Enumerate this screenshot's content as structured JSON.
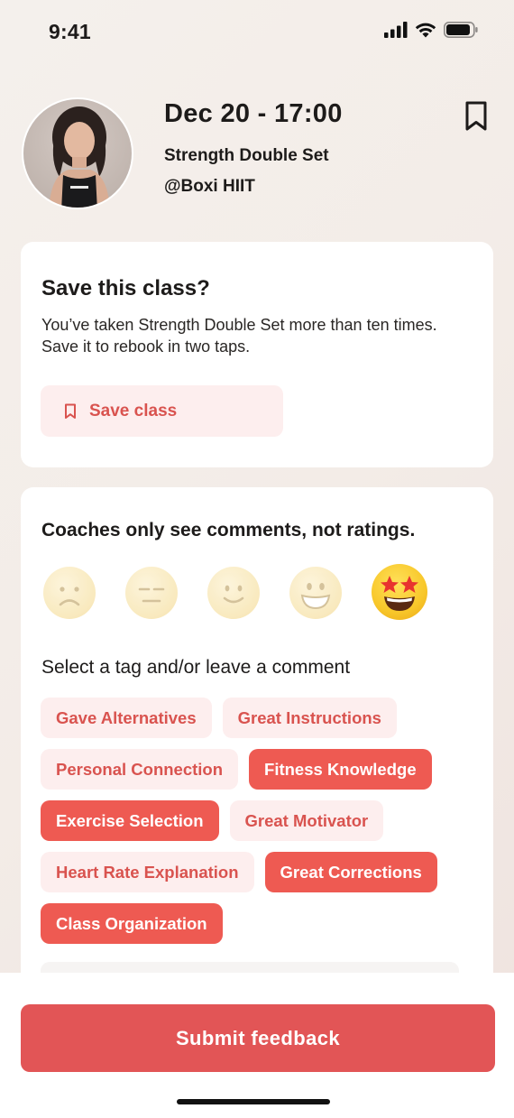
{
  "status_bar": {
    "time": "9:41"
  },
  "header": {
    "title": "Dec 20 - 17:00",
    "class_name": "Strength Double Set",
    "handle": "@Boxi HIIT"
  },
  "save_card": {
    "title": "Save this class?",
    "description": "You’ve taken Strength Double Set more than ten times. Save it to rebook in two taps.",
    "button_label": "Save class"
  },
  "rating_card": {
    "title": "Coaches only see comments, not ratings.",
    "emojis": [
      "frowning-face",
      "expressionless-face",
      "slightly-smiling-face",
      "grinning-face",
      "star-struck-face"
    ],
    "selected_emoji": "star-struck-face",
    "tag_prompt": "Select a tag and/or leave a comment",
    "tags": [
      {
        "label": "Gave Alternatives",
        "selected": false
      },
      {
        "label": "Great Instructions",
        "selected": false
      },
      {
        "label": "Personal Connection",
        "selected": false
      },
      {
        "label": "Fitness Knowledge",
        "selected": true
      },
      {
        "label": "Exercise Selection",
        "selected": true
      },
      {
        "label": "Great Motivator",
        "selected": false
      },
      {
        "label": "Heart Rate Explanation",
        "selected": false
      },
      {
        "label": "Great Corrections",
        "selected": true
      },
      {
        "label": "Class Organization",
        "selected": true
      }
    ]
  },
  "footer": {
    "submit_label": "Submit feedback"
  },
  "colors": {
    "accent": "#ee5a52",
    "accent_soft": "#fdeeee",
    "submit": "#e25556"
  }
}
